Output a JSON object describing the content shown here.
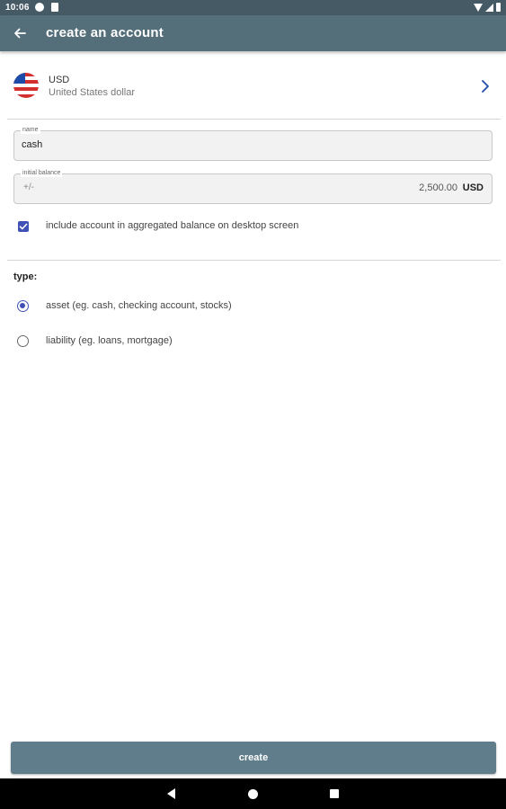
{
  "status_bar": {
    "time": "10:06"
  },
  "app_bar": {
    "title": "create an account"
  },
  "currency": {
    "code": "USD",
    "name": "United States dollar"
  },
  "form": {
    "name_label": "name",
    "name_value": "cash",
    "balance_label": "initial balance",
    "balance_sign": "+/-",
    "balance_value": "2,500.00",
    "balance_currency": "USD",
    "include_label": "include account in aggregated balance on desktop screen",
    "include_checked": true
  },
  "type": {
    "label": "type:",
    "options": [
      {
        "label": "asset (eg. cash, checking account, stocks)",
        "selected": true
      },
      {
        "label": "liability (eg. loans, mortgage)",
        "selected": false
      }
    ]
  },
  "actions": {
    "create_label": "create"
  },
  "colors": {
    "app_bar": "#546e7a",
    "status_bar": "#455a64",
    "accent": "#3f51b5",
    "button": "#607d8b"
  }
}
